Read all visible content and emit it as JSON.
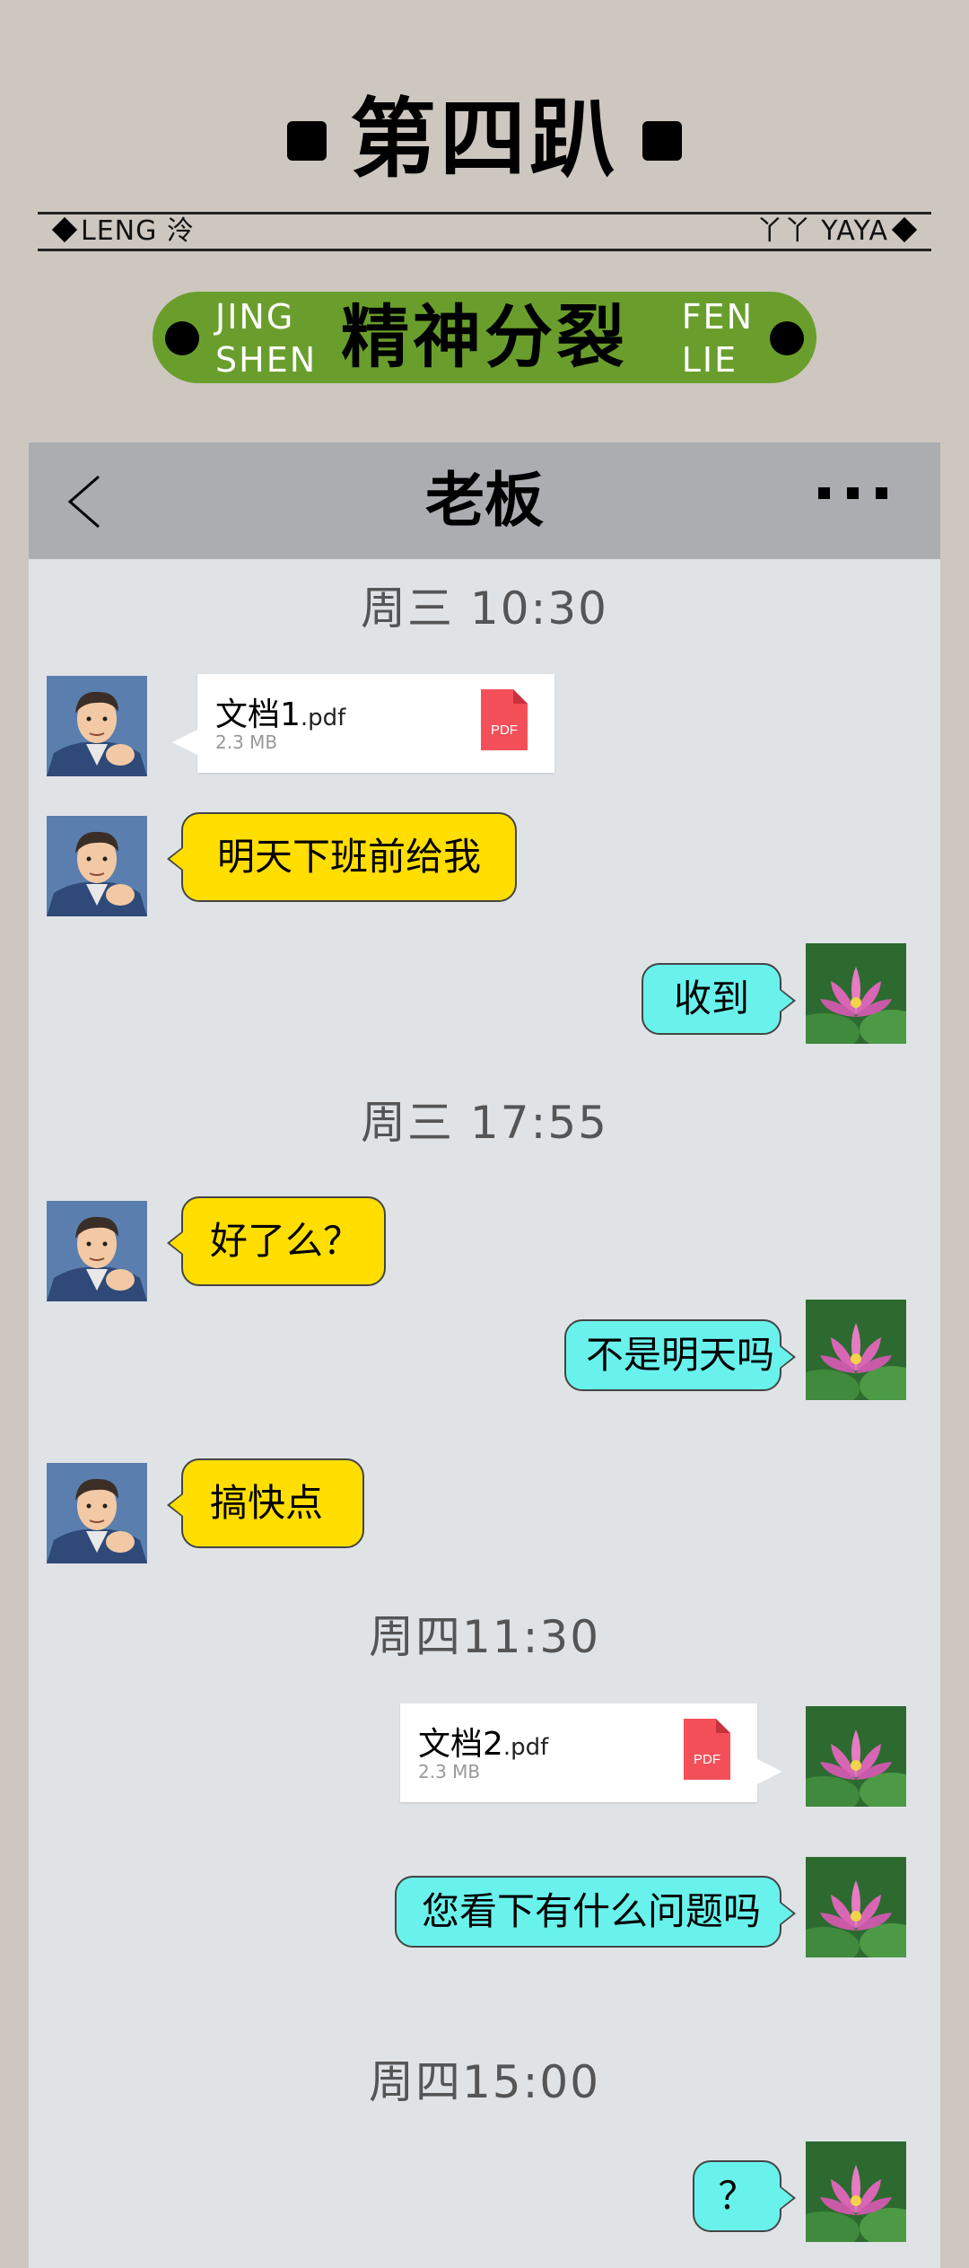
{
  "header": {
    "title": "第四趴",
    "byline_left": "LENG 泠",
    "byline_right": "丫丫 YAYA",
    "badge_main": "精神分裂",
    "badge_left_1": "JING",
    "badge_left_2": "SHEN",
    "badge_right_1": "FEN",
    "badge_right_2": "LIE",
    "badge_color": "#6a9e2c"
  },
  "chat": {
    "contact_name": "老板",
    "back_icon": "chevron-left-icon",
    "more_icon": "more-dots-icon",
    "timestamps": [
      "周三  10:30",
      "周三 17:55",
      "周四11:30",
      "周四15:00"
    ],
    "file1": {
      "name": "文档1",
      "ext": ".pdf",
      "size": "2.3 MB",
      "icon_label": "PDF"
    },
    "file2": {
      "name": "文档2",
      "ext": ".pdf",
      "size": "2.3 MB",
      "icon_label": "PDF"
    },
    "messages": {
      "m1": "明天下班前给我",
      "m2": "收到",
      "m3": "好了么？",
      "m4": "不是明天吗",
      "m5": "搞快点",
      "m6": "您看下有什么问题吗",
      "m7": "？"
    },
    "colors": {
      "boss_bubble": "#ffde00",
      "me_bubble": "#69f2ec",
      "pdf_red": "#f4505a"
    }
  }
}
